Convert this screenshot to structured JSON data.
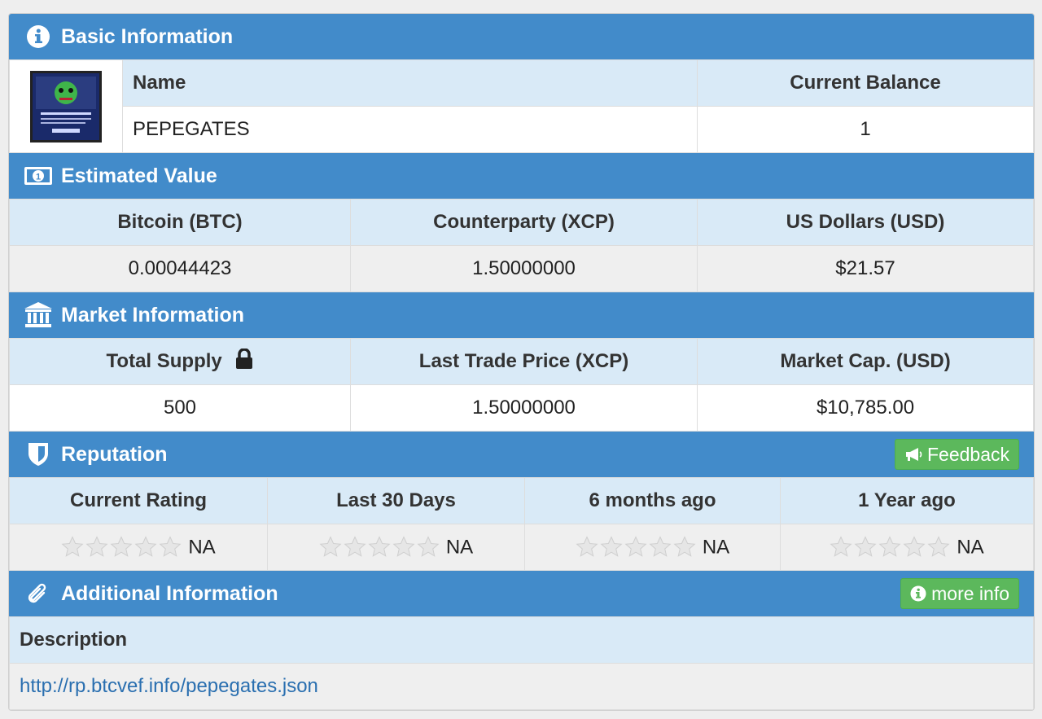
{
  "basic": {
    "title": "Basic Information",
    "icon": "info-circle-icon",
    "name_header": "Name",
    "balance_header": "Current Balance",
    "name_value": "PEPEGATES",
    "balance_value": "1"
  },
  "estimated": {
    "title": "Estimated Value",
    "icon": "money-bill-icon",
    "headers": [
      "Bitcoin (BTC)",
      "Counterparty (XCP)",
      "US Dollars (USD)"
    ],
    "values": [
      "0.00044423",
      "1.50000000",
      "$21.57"
    ]
  },
  "market": {
    "title": "Market Information",
    "icon": "bank-icon",
    "headers": [
      "Total Supply",
      "Last Trade Price (XCP)",
      "Market Cap. (USD)"
    ],
    "values": [
      "500",
      "1.50000000",
      "$10,785.00"
    ]
  },
  "reputation": {
    "title": "Reputation",
    "icon": "shield-icon",
    "feedback_label": "Feedback",
    "headers": [
      "Current Rating",
      "Last 30 Days",
      "6 months ago",
      "1 Year ago"
    ],
    "ratings": [
      "NA",
      "NA",
      "NA",
      "NA"
    ],
    "stars_filled": [
      0,
      0,
      0,
      0
    ]
  },
  "additional": {
    "title": "Additional Information",
    "icon": "paperclip-icon",
    "more_info_label": "more info",
    "description_header": "Description",
    "description_link": "http://rp.btcvef.info/pepegates.json"
  },
  "colors": {
    "header_blue": "#428bca",
    "row_light_blue": "#d9eaf7",
    "button_green": "#5cb85c",
    "link_blue": "#2a6fb0"
  }
}
